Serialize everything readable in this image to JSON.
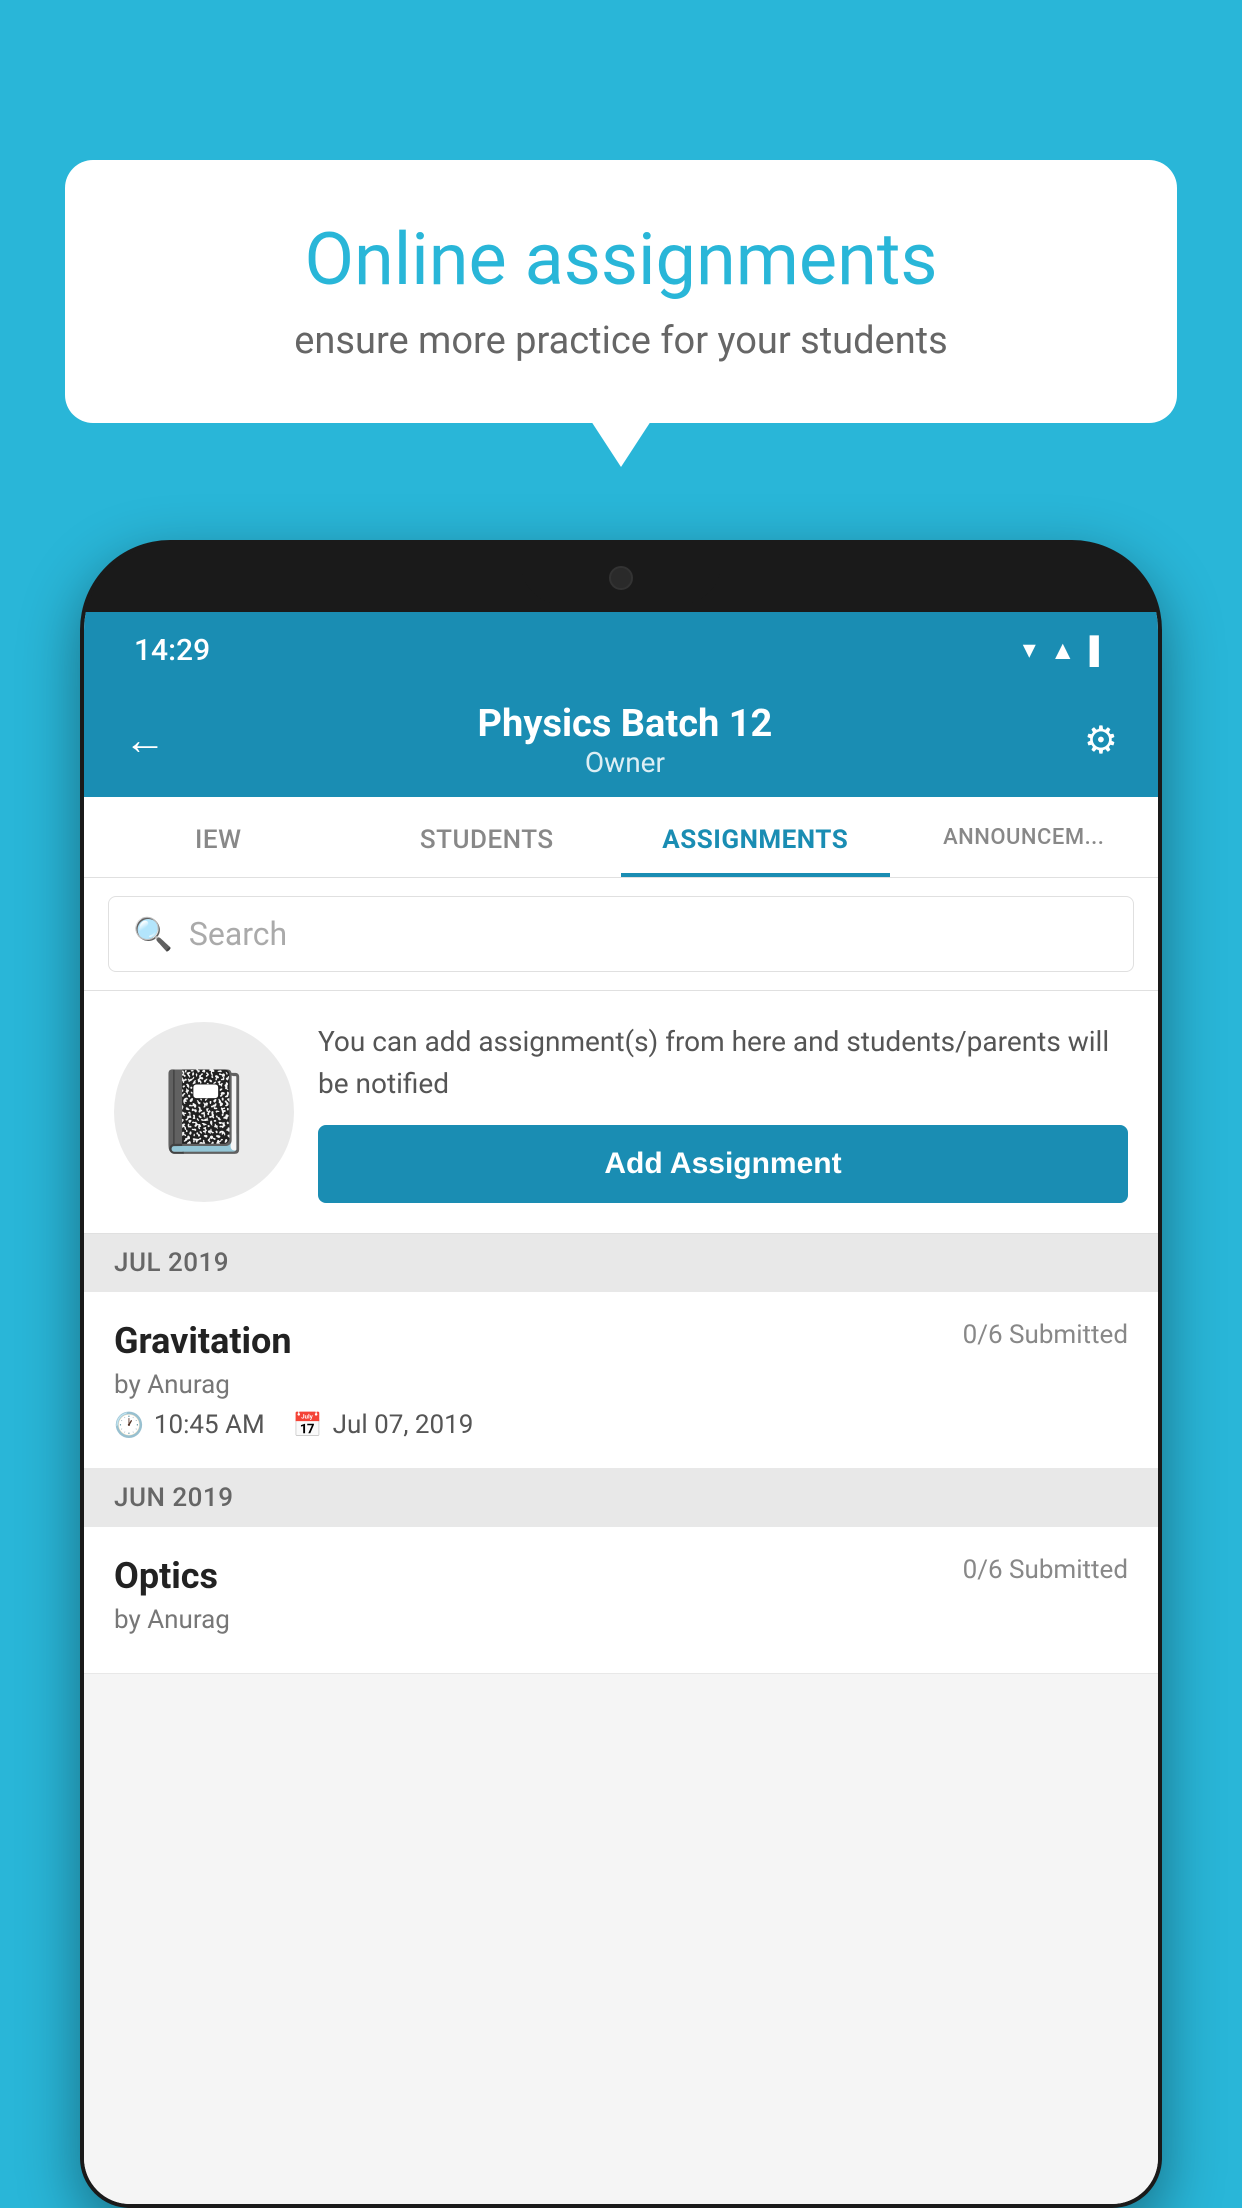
{
  "background_color": "#29B6D8",
  "bubble": {
    "title": "Online assignments",
    "subtitle": "ensure more practice for your students"
  },
  "phone": {
    "status_bar": {
      "time": "14:29",
      "icons": [
        "wifi",
        "signal",
        "battery"
      ]
    },
    "header": {
      "title": "Physics Batch 12",
      "subtitle": "Owner",
      "back_label": "←",
      "settings_label": "⚙"
    },
    "tabs": [
      {
        "label": "IEW",
        "active": false
      },
      {
        "label": "STUDENTS",
        "active": false
      },
      {
        "label": "ASSIGNMENTS",
        "active": true
      },
      {
        "label": "ANNOUNCEM...",
        "active": false
      }
    ],
    "search": {
      "placeholder": "Search"
    },
    "promo": {
      "text": "You can add assignment(s) from here and students/parents will be notified",
      "button_label": "Add Assignment"
    },
    "sections": [
      {
        "label": "JUL 2019",
        "assignments": [
          {
            "name": "Gravitation",
            "submitted": "0/6 Submitted",
            "author": "by Anurag",
            "time": "10:45 AM",
            "date": "Jul 07, 2019"
          }
        ]
      },
      {
        "label": "JUN 2019",
        "assignments": [
          {
            "name": "Optics",
            "submitted": "0/6 Submitted",
            "author": "by Anurag",
            "time": "",
            "date": ""
          }
        ]
      }
    ]
  }
}
